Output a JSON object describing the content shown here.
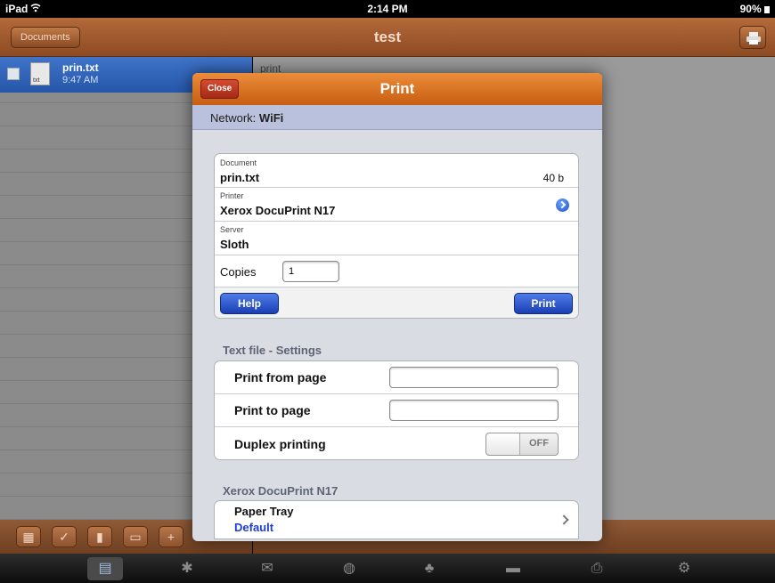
{
  "status_bar": {
    "device": "iPad",
    "wifi_icon": "wifi-icon",
    "time": "2:14 PM",
    "battery": "90%"
  },
  "nav": {
    "back_label": "Documents",
    "title": "test",
    "action_icon": "printer-icon"
  },
  "file_list": [
    {
      "name": "prin.txt",
      "time": "9:47 AM",
      "type": "txt"
    }
  ],
  "content": {
    "preview_text": "print"
  },
  "toolbar": {
    "icons": [
      "select-all-icon",
      "check-icon",
      "trash-icon",
      "comment-icon",
      "add-icon"
    ]
  },
  "tabbar": {
    "icons": [
      "documents-tab-icon",
      "favorites-tab-icon",
      "mail-tab-icon",
      "web-tab-icon",
      "network-tab-icon",
      "display-tab-icon",
      "printer-tab-icon",
      "settings-tab-icon"
    ]
  },
  "print_dialog": {
    "close_label": "Close",
    "title": "Print",
    "network_label": "Network:",
    "network_value": "WiFi",
    "document_label": "Document",
    "document_value": "prin.txt",
    "document_size": "40 b",
    "printer_label": "Printer",
    "printer_value": "Xerox DocuPrint N17",
    "server_label": "Server",
    "server_value": "Sloth",
    "copies_label": "Copies",
    "copies_value": "1",
    "help_label": "Help",
    "print_label": "Print",
    "text_settings_header": "Text file - Settings",
    "print_from_label": "Print from page",
    "print_from_value": "",
    "print_to_label": "Print to page",
    "print_to_value": "",
    "duplex_label": "Duplex printing",
    "duplex_state": "OFF",
    "printer_section_header": "Xerox DocuPrint N17",
    "paper_tray_label": "Paper Tray",
    "paper_tray_value": "Default"
  }
}
